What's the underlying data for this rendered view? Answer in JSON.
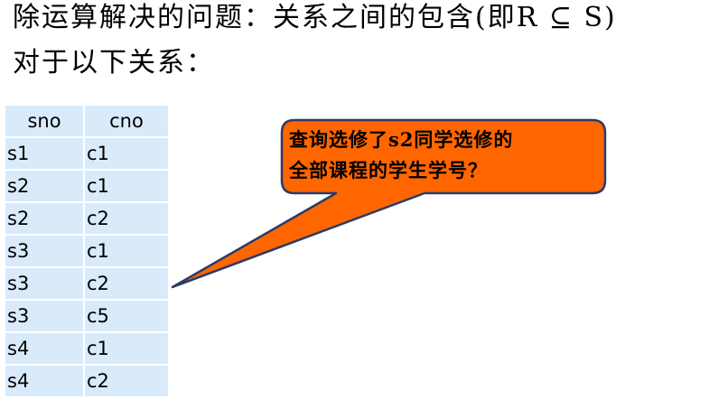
{
  "title": {
    "line1": "除运算解决的问题：关系之间的包含(即R ⊆ S)",
    "line2": "对于以下关系："
  },
  "relation": {
    "headers": [
      "sno",
      "cno"
    ],
    "rows": [
      [
        "s1",
        "c1"
      ],
      [
        "s2",
        "c1"
      ],
      [
        "s2",
        "c2"
      ],
      [
        "s3",
        "c1"
      ],
      [
        "s3",
        "c2"
      ],
      [
        "s3",
        "c5"
      ],
      [
        "s4",
        "c1"
      ],
      [
        "s4",
        "c2"
      ]
    ]
  },
  "callout": {
    "line1": "查询选修了s2同学选修的",
    "line2": "全部课程的学生学号？",
    "fill_color": "#ff6600",
    "border_color": "#2b3a67"
  }
}
